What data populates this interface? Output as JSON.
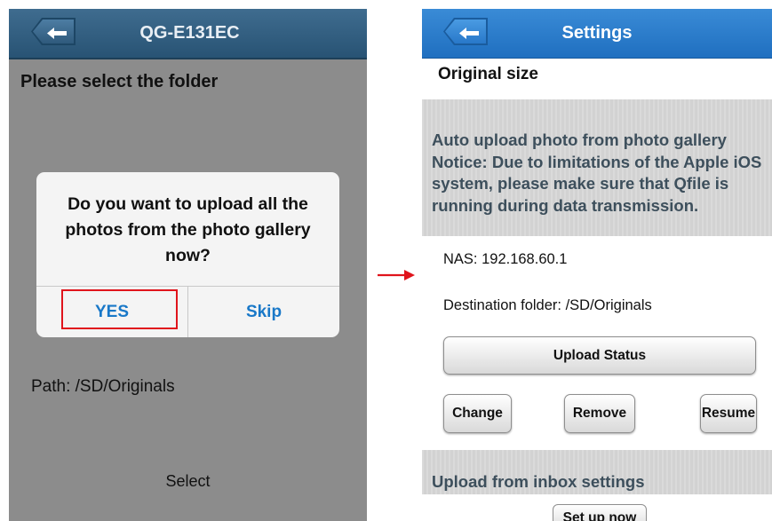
{
  "left_screen": {
    "nav_title": "QG-E131EC",
    "heading": "Please select the folder",
    "dialog": {
      "message": "Do you want to upload all the photos from the photo gallery now?",
      "yes_label": "YES",
      "skip_label": "Skip"
    },
    "path": "Path: /SD/Originals",
    "select_label": "Select"
  },
  "right_screen": {
    "nav_title": "Settings",
    "original_size": "Original size",
    "notice": "Auto upload photo from photo gallery Notice: Due to limitations of the Apple iOS system, please make sure that Qfile is running during data transmission.",
    "nas": "NAS: 192.168.60.1",
    "destination": "Destination folder: /SD/Originals",
    "upload_status_label": "Upload Status",
    "change_label": "Change",
    "remove_label": "Remove",
    "resume_label": "Resume",
    "inbox_heading": "Upload from inbox settings",
    "setup_label": "Set up now"
  },
  "colors": {
    "left_nav": "#2f5a7c",
    "right_nav": "#2a7dcb",
    "highlight": "#e0141c",
    "dialog_button": "#1978c8"
  },
  "icons": {
    "back": "back-arrow-icon",
    "transition": "right-arrow-icon"
  }
}
